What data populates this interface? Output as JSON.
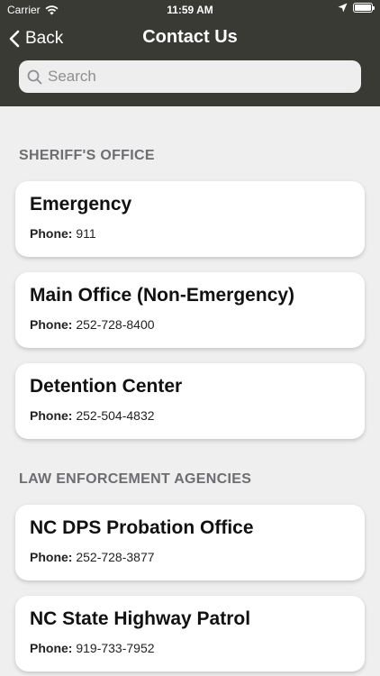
{
  "status_bar": {
    "carrier": "Carrier",
    "time": "11:59 AM"
  },
  "nav": {
    "back_label": "Back",
    "title": "Contact Us"
  },
  "search": {
    "placeholder": "Search"
  },
  "sections": [
    {
      "title": "SHERIFF'S OFFICE",
      "contacts": [
        {
          "name": "Emergency",
          "phone_label": "Phone:",
          "phone": "911"
        },
        {
          "name": "Main Office (Non-Emergency)",
          "phone_label": "Phone:",
          "phone": "252-728-8400"
        },
        {
          "name": "Detention Center",
          "phone_label": "Phone:",
          "phone": "252-504-4832"
        }
      ]
    },
    {
      "title": "LAW ENFORCEMENT AGENCIES",
      "contacts": [
        {
          "name": "NC DPS Probation Office",
          "phone_label": "Phone:",
          "phone": "252-728-3877"
        },
        {
          "name": "NC State Highway Patrol",
          "phone_label": "Phone:",
          "phone": "919-733-7952"
        }
      ]
    }
  ],
  "colors": {
    "header_bg": "#3a3a35",
    "page_bg": "#efefef",
    "section_header": "#6d6d72"
  },
  "icons": {
    "wifi": "wifi-icon",
    "location": "location-arrow-icon",
    "battery": "battery-icon",
    "back": "chevron-left-icon",
    "search": "search-icon"
  }
}
